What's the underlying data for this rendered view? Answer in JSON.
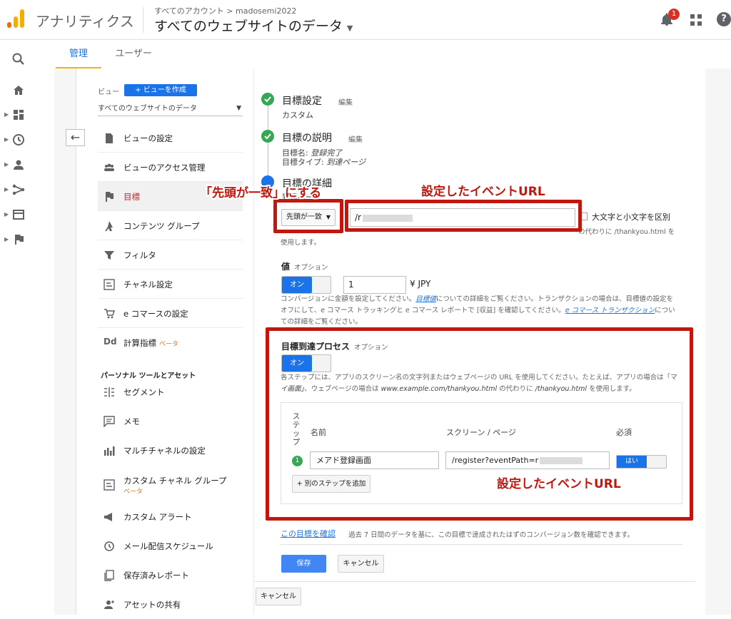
{
  "header": {
    "app_name": "アナリティクス",
    "breadcrumb": "すべてのアカウント > madosemi2022",
    "property_title": "すべてのウェブサイトのデータ",
    "notification_count": "1",
    "help": "?"
  },
  "tabs": {
    "admin": "管理",
    "user": "ユーザー"
  },
  "view": {
    "label": "ビュー",
    "create_button": "+ ビューを作成",
    "selected_view": "すべてのウェブサイトのデータ",
    "back_arrow": "←",
    "items": [
      {
        "label": "ビューの設定",
        "icon": "document-icon"
      },
      {
        "label": "ビューのアクセス管理",
        "icon": "people-icon"
      },
      {
        "label": "目標",
        "icon": "flag-icon"
      },
      {
        "label": "コンテンツ グループ",
        "icon": "person-walk-icon"
      },
      {
        "label": "フィルタ",
        "icon": "filter-icon"
      },
      {
        "label": "チャネル設定",
        "icon": "channel-icon"
      },
      {
        "label": "e コマースの設定",
        "icon": "cart-icon"
      },
      {
        "label": "計算指標",
        "badge": "ベータ",
        "icon": "dd-icon"
      }
    ],
    "section_header": "パーソナル ツールとアセット",
    "personal_items": [
      {
        "label": "セグメント",
        "icon": "segment-icon"
      },
      {
        "label": "メモ",
        "icon": "memo-icon"
      },
      {
        "label": "マルチチャネルの設定",
        "icon": "bar-chart-icon"
      },
      {
        "label": "カスタム チャネル グループ",
        "badge": "ベータ",
        "icon": "channel-icon"
      },
      {
        "label": "カスタム アラート",
        "icon": "megaphone-icon"
      },
      {
        "label": "メール配信スケジュール",
        "icon": "clock-icon"
      },
      {
        "label": "保存済みレポート",
        "icon": "copy-icon"
      },
      {
        "label": "アセットの共有",
        "icon": "share-person-icon"
      }
    ]
  },
  "goal": {
    "step1": {
      "title": "目標設定",
      "edit": "編集",
      "sub": "カスタム"
    },
    "step2": {
      "title": "目標の説明",
      "edit": "編集",
      "sub1_prefix": "目標名: ",
      "sub1_value": "登録完了",
      "sub2_prefix": "目標タイプ: ",
      "sub2_value": "到達ページ"
    },
    "step3": {
      "title": "目標の詳細",
      "sub": "到達ページ"
    },
    "match_type": "先頭が一致",
    "url_value": "/r",
    "case_label": "大文字と小文字を区別",
    "url_help_end": "の代わりに /thankyou.html を",
    "url_help_line2": "使用します。",
    "value": {
      "title": "値",
      "option": "オプション",
      "toggle": "オン",
      "amount": "1",
      "currency": "¥ JPY",
      "help_line1_a": "コンバージョンに金額を設定してください。",
      "help_line1_link": "目標値",
      "help_line1_b": "についての詳細をご覧ください。トランザクションの場合は、目標値の設定を",
      "help_line2_a": "オフにして、e コマース トラッキングと e コマース レポートで [収益] を確認してください。",
      "help_line2_link": "e コマース トランザクション",
      "help_line2_b": "につい",
      "help_line3": "ての詳細をご覧ください。"
    },
    "funnel": {
      "title": "目標到達プロセス",
      "option": "オプション",
      "toggle": "オン",
      "help_line1": "各ステップには、アプリのスクリーン名の文字列またはウェブページの URL を使用してください。たとえば、アプリの場合は「マ",
      "help_line2_a": "イ画面」",
      "help_line2_b": "、ウェブページの場合は ",
      "help_line2_c": "www.example.com/thankyou.html",
      "help_line2_d": " の代わりに ",
      "help_line2_e": "/thankyou.html",
      "help_line2_f": " を使用します。",
      "col_step": "ステップ",
      "col_name": "名前",
      "col_page": "スクリーン / ページ",
      "col_required": "必須",
      "rows": [
        {
          "num": "1",
          "name": "メアド登録画面",
          "page": "/register?eventPath=r",
          "required": "はい"
        }
      ],
      "add_step": "+ 別のステップを追加"
    },
    "verify_link": "この目標を確認",
    "verify_desc": "過去 7 日間のデータを基に、この目標で達成されたはずのコンバージョン数を確認できます。",
    "save": "保存",
    "cancel": "キャンセル",
    "cancel_outer": "キャンセル"
  },
  "annotations": {
    "match": "「先頭が一致」にする",
    "event_url_top": "設定したイベントURL",
    "event_url_bottom": "設定したイベントURL"
  },
  "colors": {
    "accent": "#1a73e8",
    "annotation_red": "#c0180f",
    "success_green": "#34a853",
    "logo_orange": "#f9ab00"
  }
}
